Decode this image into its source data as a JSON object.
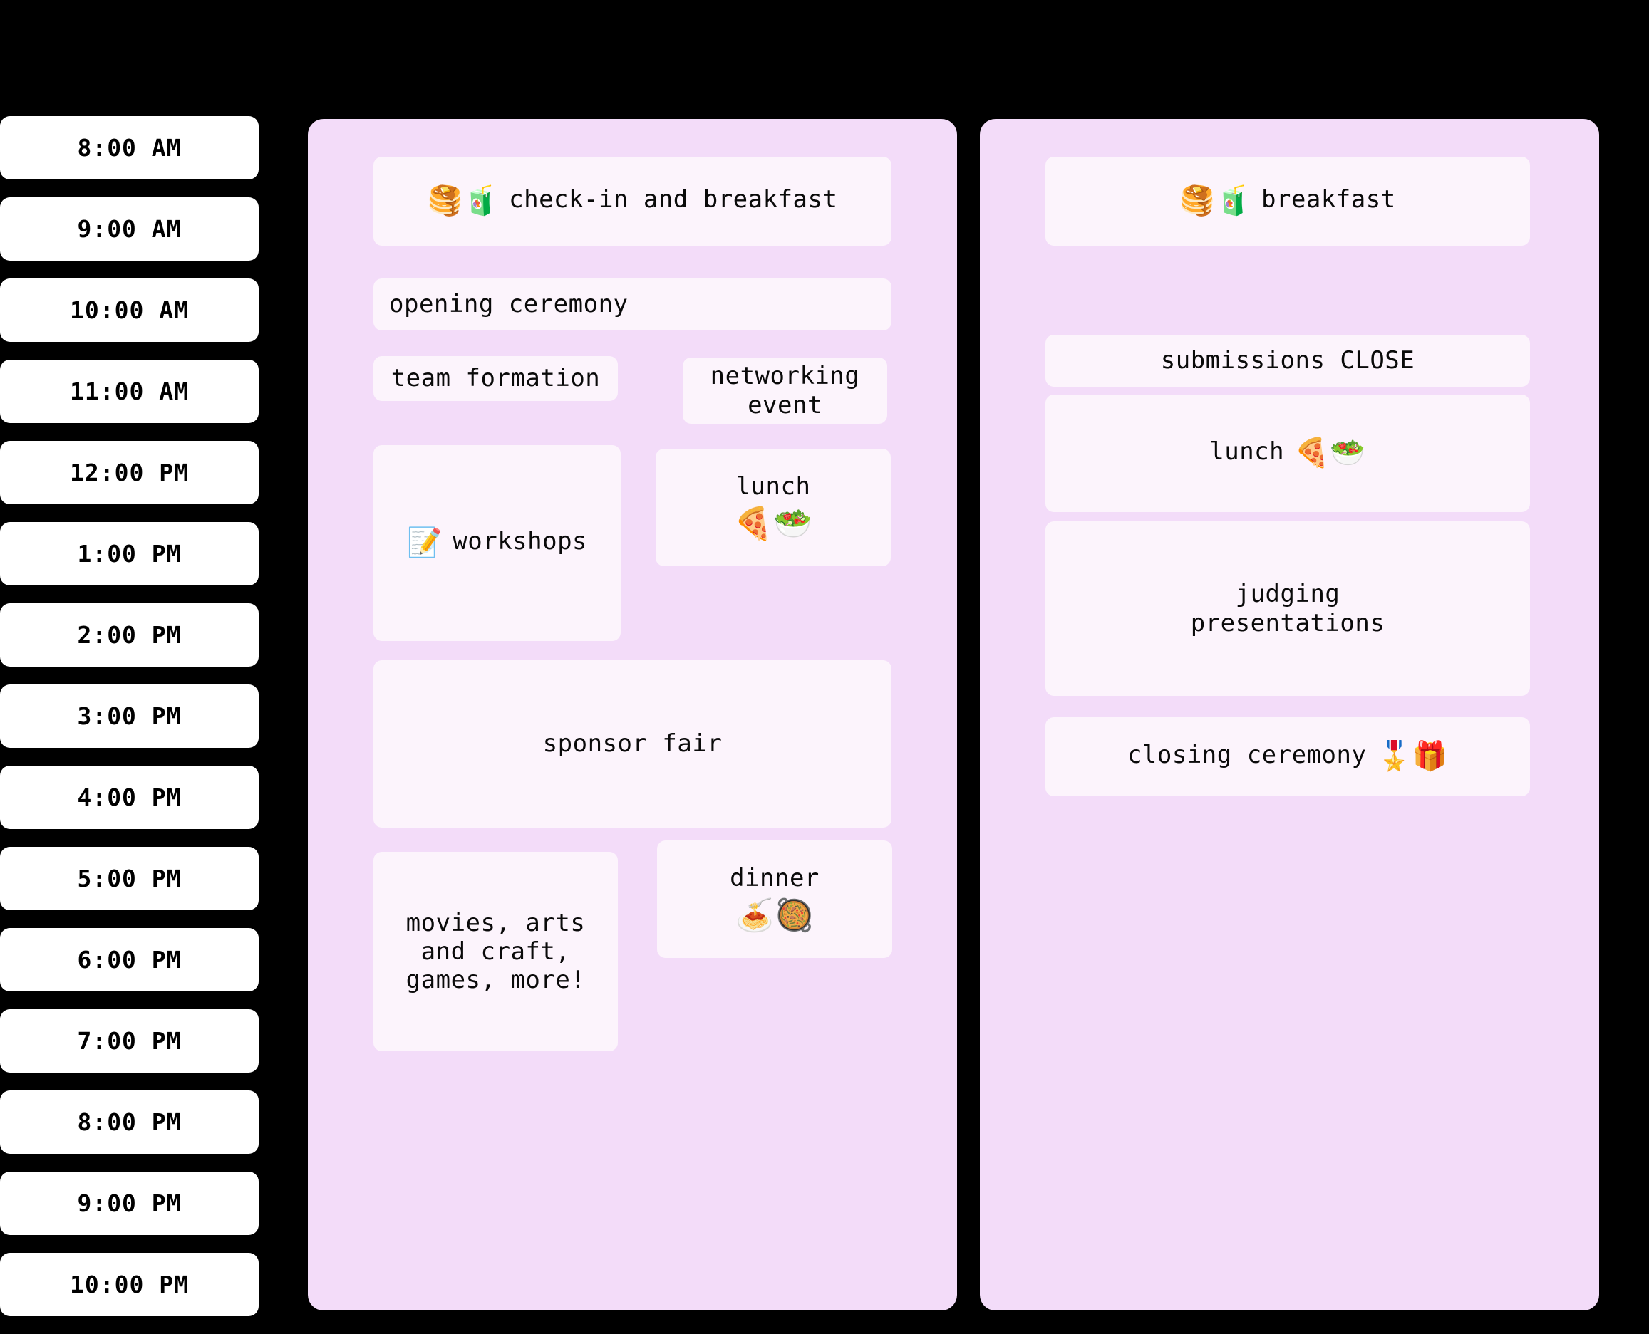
{
  "schedule": {
    "time_rail": {
      "times": [
        "8:00 AM",
        "9:00 AM",
        "10:00 AM",
        "11:00 AM",
        "12:00 PM",
        "1:00 PM",
        "2:00 PM",
        "3:00 PM",
        "4:00 PM",
        "5:00 PM",
        "6:00 PM",
        "7:00 PM",
        "8:00 PM",
        "9:00 PM",
        "10:00 PM"
      ]
    },
    "colors": {
      "page_background": "#000000",
      "column_background": "#f3dcf9",
      "card_background": "#fcf4fc",
      "time_cell_background": "#ffffff",
      "text": "#0a0a0a"
    },
    "day_one": {
      "events": {
        "checkin": {
          "emoji": "🥞🧃",
          "emoji_names": "pancakes-icon juice-box-icon",
          "label": "check-in and breakfast"
        },
        "opening": {
          "label": "opening ceremony"
        },
        "team_formation": {
          "label": "team formation"
        },
        "networking": {
          "label": "networking\nevent"
        },
        "workshops": {
          "emoji": "📝",
          "emoji_names": "memo-icon",
          "label": "workshops"
        },
        "lunch": {
          "label": "lunch",
          "emoji": "🍕🥗",
          "emoji_names": "pizza-icon salad-icon"
        },
        "sponsor_fair": {
          "label": "sponsor fair"
        },
        "evening": {
          "label": "movies, arts\nand craft,\ngames, more!"
        },
        "dinner": {
          "label": "dinner",
          "emoji": "🍝🥘",
          "emoji_names": "spaghetti-icon shallow-pan-icon"
        }
      }
    },
    "day_two": {
      "events": {
        "breakfast": {
          "emoji": "🥞🧃",
          "emoji_names": "pancakes-icon juice-box-icon",
          "label": "breakfast"
        },
        "submissions_close": {
          "label": "submissions CLOSE"
        },
        "lunch": {
          "label": "lunch",
          "emoji": "🍕🥗",
          "emoji_names": "pizza-icon salad-icon"
        },
        "judging": {
          "label": "judging\npresentations"
        },
        "closing": {
          "label": "closing ceremony",
          "emoji": "🎖️🎁",
          "emoji_names": "military-medal-icon wrapped-gift-icon"
        }
      }
    }
  }
}
